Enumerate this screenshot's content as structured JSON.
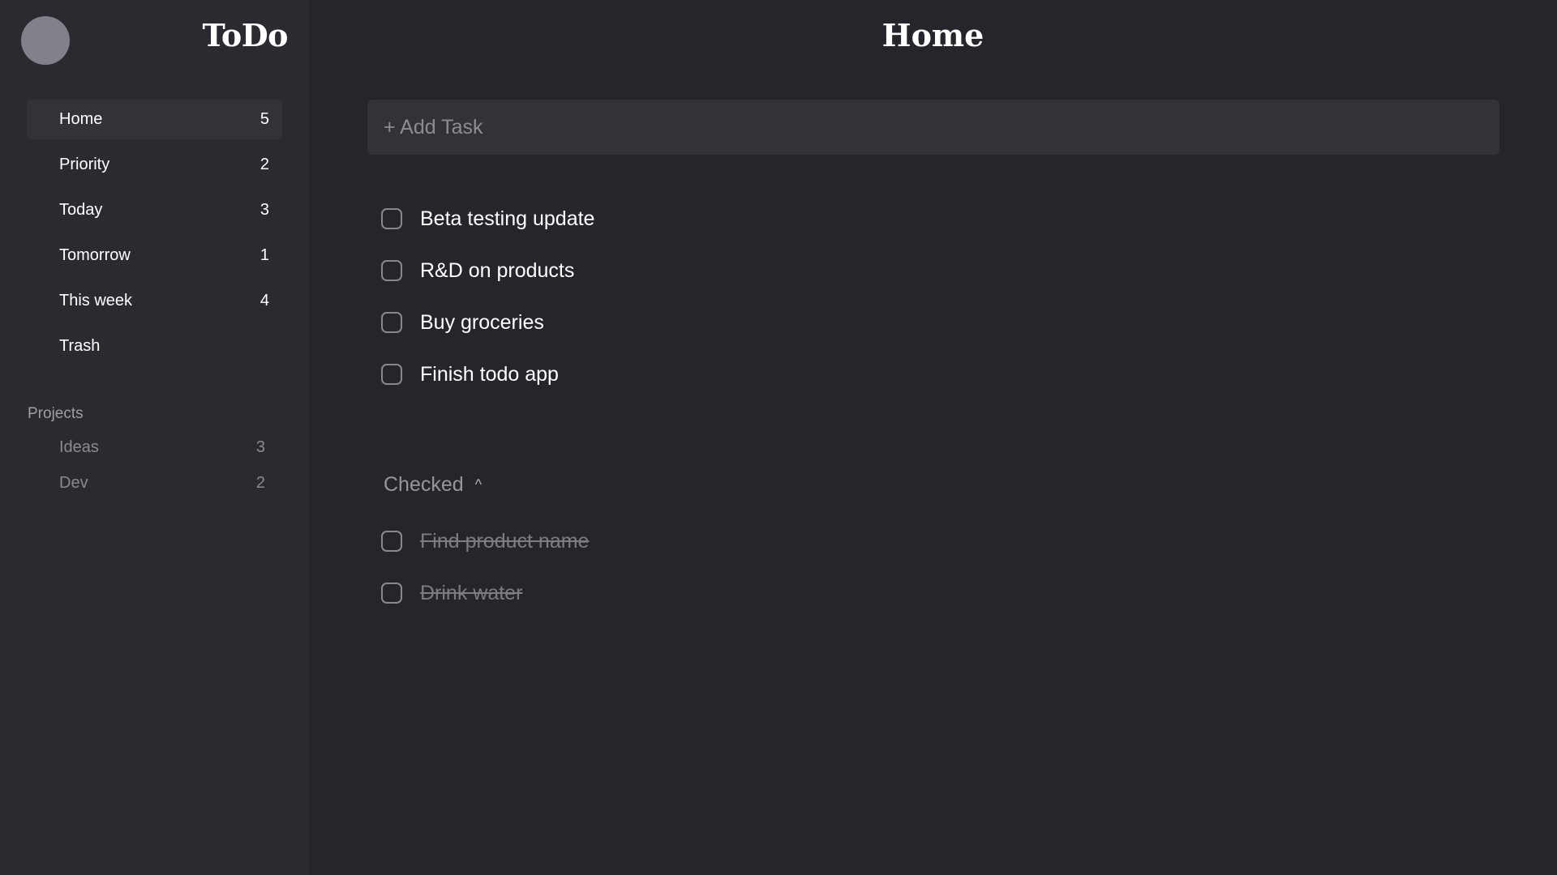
{
  "brand": "ToDo",
  "sidebar": {
    "nav": [
      {
        "label": "Home",
        "count": "5"
      },
      {
        "label": "Priority",
        "count": "2"
      },
      {
        "label": "Today",
        "count": "3"
      },
      {
        "label": "Tomorrow",
        "count": "1"
      },
      {
        "label": "This week",
        "count": "4"
      },
      {
        "label": "Trash",
        "count": ""
      }
    ],
    "projects_heading": "Projects",
    "projects": [
      {
        "label": "Ideas",
        "count": "3"
      },
      {
        "label": "Dev",
        "count": "2"
      }
    ]
  },
  "main": {
    "title": "Home",
    "add_task_placeholder": "+ Add Task",
    "tasks": [
      {
        "label": "Beta testing update"
      },
      {
        "label": "R&D on products"
      },
      {
        "label": "Buy groceries"
      },
      {
        "label": "Finish todo app"
      }
    ],
    "checked_label": "Checked",
    "checked_tasks": [
      {
        "label": "Find product name"
      },
      {
        "label": "Drink water"
      }
    ]
  },
  "colors": {
    "background": "#26252b",
    "sidebar": "#2b2a30",
    "active_item": "#333238",
    "avatar": "#828088"
  }
}
